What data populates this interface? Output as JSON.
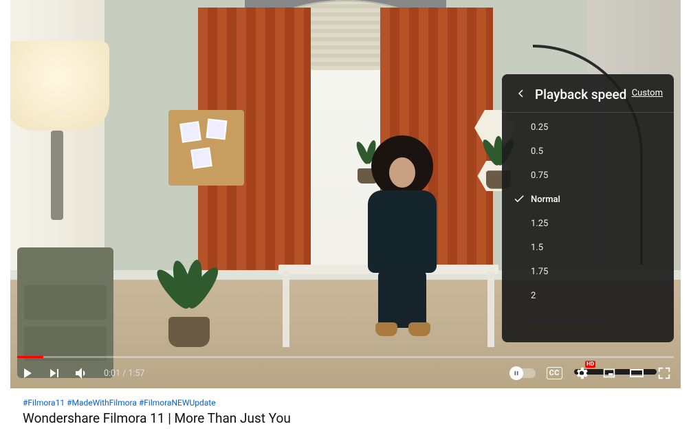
{
  "menu": {
    "header_label": "Playback speed",
    "custom_label": "Custom",
    "options": [
      "0.25",
      "0.5",
      "0.75",
      "Normal",
      "1.25",
      "1.5",
      "1.75",
      "2"
    ],
    "selected_index": 3
  },
  "controls": {
    "current_time": "0:01",
    "duration": "1:57",
    "cc_label": "CC",
    "hd_label": "HD"
  },
  "hashtags": [
    "#Filmora11",
    "#MadeWithFilmora",
    "#FilmoraNEWUpdate"
  ],
  "video_title": "Wondershare Filmora 11 | More Than Just You"
}
